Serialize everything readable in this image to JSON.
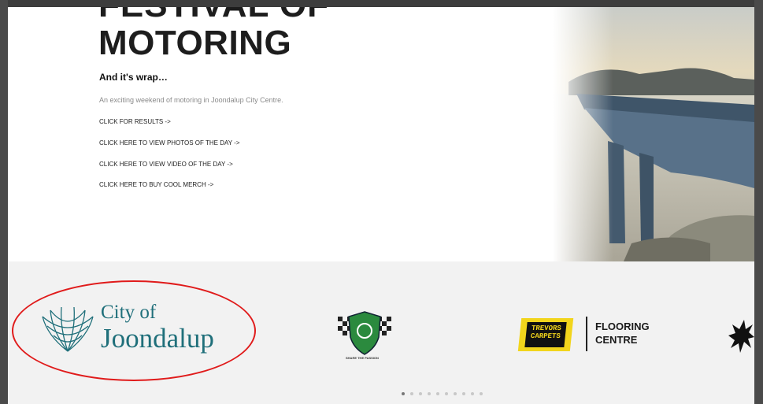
{
  "hero": {
    "title_line1": "FESTIVAL OF",
    "title_line2": "MOTORING",
    "subheading": "And it's wrap…",
    "description": "An exciting weekend of motoring in Joondalup City Centre.",
    "links": [
      "CLICK FOR RESULTS ->",
      "CLICK HERE TO VIEW PHOTOS OF THE DAY ->",
      "CLICK HERE TO VIEW VIDEO OF THE DAY ->",
      "CLICK HERE TO BUY COOL MERCH ->"
    ]
  },
  "sponsors": {
    "joondalup": {
      "line1": "City of",
      "line2": "Joondalup",
      "color": "#1f6f7a"
    },
    "checkered": {
      "caption": "SHARE THE PASSION"
    },
    "trevors": {
      "badge_line1": "TREVORS",
      "badge_line2": "CARPETS",
      "line1": "FLOORING",
      "line2": "CENTRE"
    }
  },
  "carousel": {
    "dot_count": 10,
    "active_index": 0
  },
  "annotation": {
    "color": "#e01b1b"
  }
}
